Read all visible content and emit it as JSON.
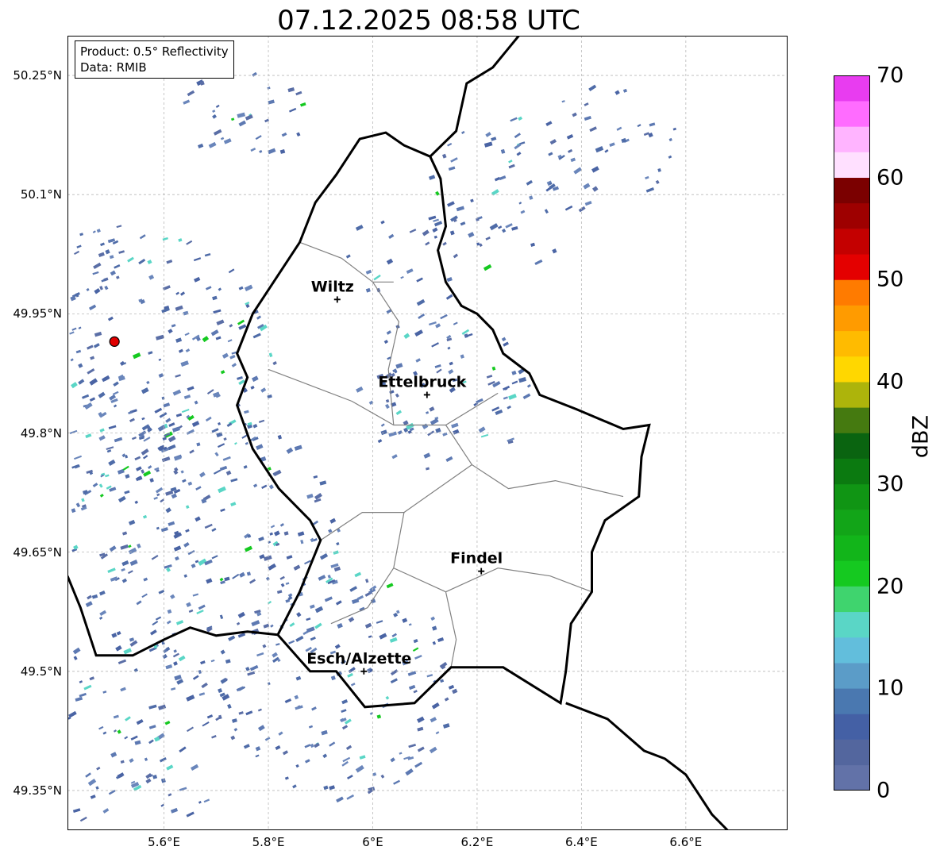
{
  "title": "07.12.2025 08:58 UTC",
  "info": {
    "product": "Product: 0.5° Reflectivity",
    "source": "Data: RMIB"
  },
  "map": {
    "lon_range": [
      5.415,
      6.795
    ],
    "lat_range": [
      49.3,
      50.3
    ],
    "lon_ticks": [
      5.6,
      5.8,
      6.0,
      6.2,
      6.4,
      6.6
    ],
    "lon_tick_labels": [
      "5.6°E",
      "5.8°E",
      "6°E",
      "6.2°E",
      "6.4°E",
      "6.6°E"
    ],
    "lat_ticks": [
      49.35,
      49.5,
      49.65,
      49.8,
      49.95,
      50.1,
      50.25
    ],
    "lat_tick_labels": [
      "49.35°N",
      "49.5°N",
      "49.65°N",
      "49.8°N",
      "49.95°N",
      "50.1°N",
      "50.25°N"
    ],
    "radar_site": {
      "lon": 5.505,
      "lat": 49.915,
      "color": "#e00000"
    },
    "cities": [
      {
        "name": "Wiltz",
        "lon": 5.932,
        "lat": 49.968
      },
      {
        "name": "Ettelbruck",
        "lon": 6.104,
        "lat": 49.848
      },
      {
        "name": "Findel",
        "lon": 6.208,
        "lat": 49.626
      },
      {
        "name": "Esch/Alzette",
        "lon": 5.983,
        "lat": 49.5
      }
    ],
    "border_color": "#000000",
    "canton_color": "#808080",
    "grid": true
  },
  "colorbar": {
    "label": "dBZ",
    "min": 0,
    "max": 70,
    "ticks": [
      0,
      10,
      20,
      30,
      40,
      50,
      60,
      70
    ],
    "tick_labels": [
      "0",
      "10",
      "20",
      "30",
      "40",
      "50",
      "60",
      "70"
    ],
    "colors": [
      "#6272a8",
      "#53669e",
      "#4460a5",
      "#4a78b0",
      "#5b9cc8",
      "#62bedc",
      "#5ad6c6",
      "#3fd46e",
      "#15c920",
      "#12b51a",
      "#12a518",
      "#109514",
      "#0b7a10",
      "#0a6410",
      "#457a10",
      "#adb40b",
      "#ffd700",
      "#ffbb00",
      "#ff9b00",
      "#ff7b00",
      "#e40000",
      "#c40000",
      "#9e0000",
      "#7b0000",
      "#ffe0ff",
      "#ffb4ff",
      "#ff6cff",
      "#e83cf0"
    ]
  }
}
